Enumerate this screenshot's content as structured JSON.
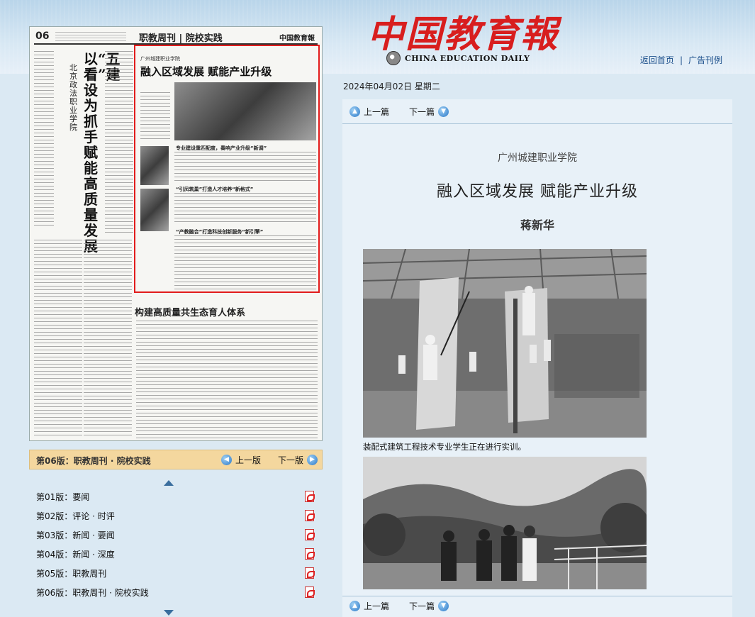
{
  "header": {
    "logo_cn": "中国教育報",
    "logo_en": "CHINA EDUCATION DAILY",
    "links": [
      "返回首页",
      "广告刊例"
    ],
    "separator": "|"
  },
  "paper_page": {
    "page_num": "06",
    "section": "职教周刊 | 院校实践",
    "logo_small": "中国教育報",
    "left_headline": "以“五看”建设为抓手赋能高质量发展",
    "left_kicker": "北京政法职业学院",
    "highlighted_org": "广州城建职业学院",
    "highlighted_title": "融入区域发展 赋能产业升级",
    "sub_heads": [
      "专业建设重匹配度，奏响产业升级“新调”",
      "“引凤筑巢”打造人才培养“新格式”",
      "“产教融合”打造科技创新服务“新引擎”"
    ],
    "bottom_title": "构建高质量共生态育人体系"
  },
  "pager": {
    "current": "第06版：职教周刊 · 院校实践",
    "prev": "上一版",
    "next": "下一版"
  },
  "editions": [
    "第01版：要闻",
    "第02版：评论 · 时评",
    "第03版：新闻 · 要闻",
    "第04版：新闻 · 深度",
    "第05版：职教周刊",
    "第06版：职教周刊 · 院校实践"
  ],
  "date": "2024年04月02日  星期二",
  "article_nav": {
    "prev": "上一篇",
    "next": "下一篇"
  },
  "article": {
    "school": "广州城建职业学院",
    "title": "融入区域发展  赋能产业升级",
    "author": "蒋新华",
    "caption1": "装配式建筑工程技术专业学生正在进行实训。"
  },
  "colors": {
    "logo_red": "#d81e1e",
    "highlight_box": "#e21b1b",
    "pager_bar": "#f4d79e",
    "page_bg": "#dbe9f3",
    "link_blue": "#1a4e8a"
  }
}
